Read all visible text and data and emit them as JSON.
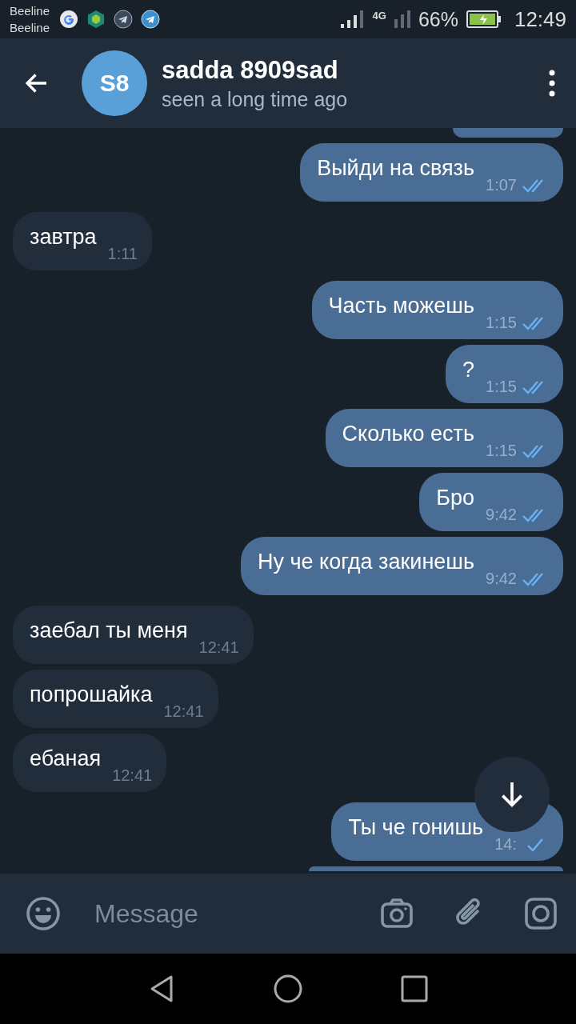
{
  "status_bar": {
    "carriers": [
      "Beeline",
      "Beeline"
    ],
    "network": "4G",
    "battery": "66%",
    "time": "12:49"
  },
  "header": {
    "avatar_initials": "S8",
    "title": "sadda 8909sad",
    "subtitle": "seen a long time ago"
  },
  "messages": [
    {
      "kind": "clipped",
      "outgoing": true
    },
    {
      "kind": "text",
      "outgoing": true,
      "text": "Выйди на связь",
      "time": "1:07",
      "read": true
    },
    {
      "kind": "text",
      "outgoing": false,
      "text": "завтра",
      "time": "1:11"
    },
    {
      "kind": "text",
      "outgoing": true,
      "text": "Часть можешь",
      "time": "1:15",
      "read": true
    },
    {
      "kind": "text",
      "outgoing": true,
      "text": "?",
      "time": "1:15",
      "read": true
    },
    {
      "kind": "text",
      "outgoing": true,
      "text": "Сколько есть",
      "time": "1:15",
      "read": true
    },
    {
      "kind": "text",
      "outgoing": true,
      "text": "Бро",
      "time": "9:42",
      "read": true
    },
    {
      "kind": "text",
      "outgoing": true,
      "text": "Ну че когда закинешь",
      "time": "9:42",
      "read": true
    },
    {
      "kind": "text",
      "outgoing": false,
      "text": "заебал ты меня",
      "time": "12:41"
    },
    {
      "kind": "text",
      "outgoing": false,
      "text": "попрошайка",
      "time": "12:41"
    },
    {
      "kind": "text",
      "outgoing": false,
      "text": "ебаная",
      "time": "12:41"
    },
    {
      "kind": "text",
      "outgoing": true,
      "text": "Ты че гонишь",
      "time": "14:",
      "read": false
    },
    {
      "kind": "clipped",
      "outgoing": true
    }
  ],
  "composer": {
    "placeholder": "Message"
  }
}
